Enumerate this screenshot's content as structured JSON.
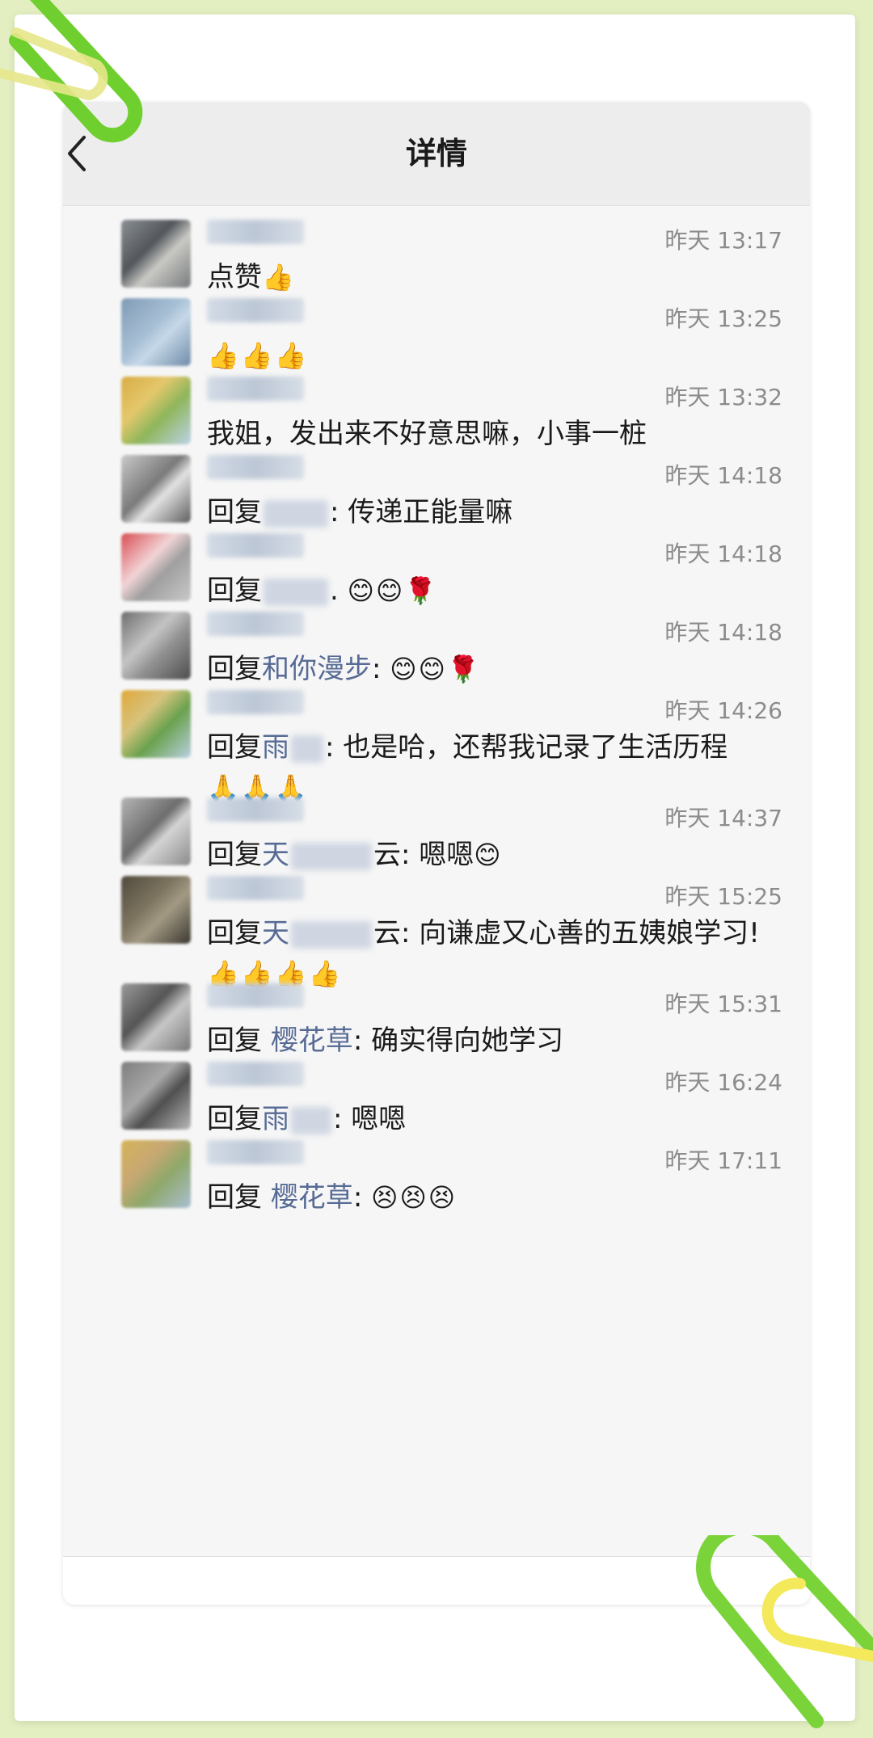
{
  "header": {
    "title": "详情"
  },
  "comments": [
    {
      "time": "昨天 13:17",
      "reply_prefix": "",
      "reply_name": "",
      "text": "点赞",
      "emoji": "👍"
    },
    {
      "time": "昨天 13:25",
      "reply_prefix": "",
      "reply_name": "",
      "text": "",
      "emoji": "👍👍👍"
    },
    {
      "time": "昨天 13:32",
      "reply_prefix": "",
      "reply_name": "",
      "text": "我姐，发出来不好意思嘛，小事一桩",
      "emoji": ""
    },
    {
      "time": "昨天 14:18",
      "reply_prefix": "回复",
      "reply_name": "",
      "text": ": 传递正能量嘛",
      "emoji": ""
    },
    {
      "time": "昨天 14:18",
      "reply_prefix": "回复",
      "reply_name": "",
      "text": ". ",
      "emoji": "😊😊🌹"
    },
    {
      "time": "昨天 14:18",
      "reply_prefix": "回复",
      "reply_name": "和你漫步",
      "text": ": ",
      "emoji": "😊😊🌹"
    },
    {
      "time": "昨天 14:26",
      "reply_prefix": "回复",
      "reply_name": "雨",
      "text": ": 也是哈，还帮我记录了生活历程",
      "emoji": "🙏🙏🙏"
    },
    {
      "time": "昨天 14:37",
      "reply_prefix": "回复",
      "reply_name": "天",
      "text": "云: 嗯嗯",
      "emoji": "😊"
    },
    {
      "time": "昨天 15:25",
      "reply_prefix": "回复",
      "reply_name": "天",
      "text": "云: 向谦虚又心善的五姨娘学习!",
      "emoji": "👍👍👍👍"
    },
    {
      "time": "昨天 15:31",
      "reply_prefix": "回复",
      "reply_name": "樱花草",
      "text": ": 确实得向她学习",
      "emoji": ""
    },
    {
      "time": "昨天 16:24",
      "reply_prefix": "回复",
      "reply_name": "雨",
      "text": ": 嗯嗯",
      "emoji": ""
    },
    {
      "time": "昨天 17:11",
      "reply_prefix": "回复",
      "reply_name": "樱花草",
      "text": ": ",
      "emoji": "😣😣😣"
    }
  ],
  "colors": {
    "accent_link": "#576b95",
    "time": "#8c8c8c",
    "background": "#e3efc1"
  },
  "icons": {
    "back": "chevron-left-icon"
  }
}
